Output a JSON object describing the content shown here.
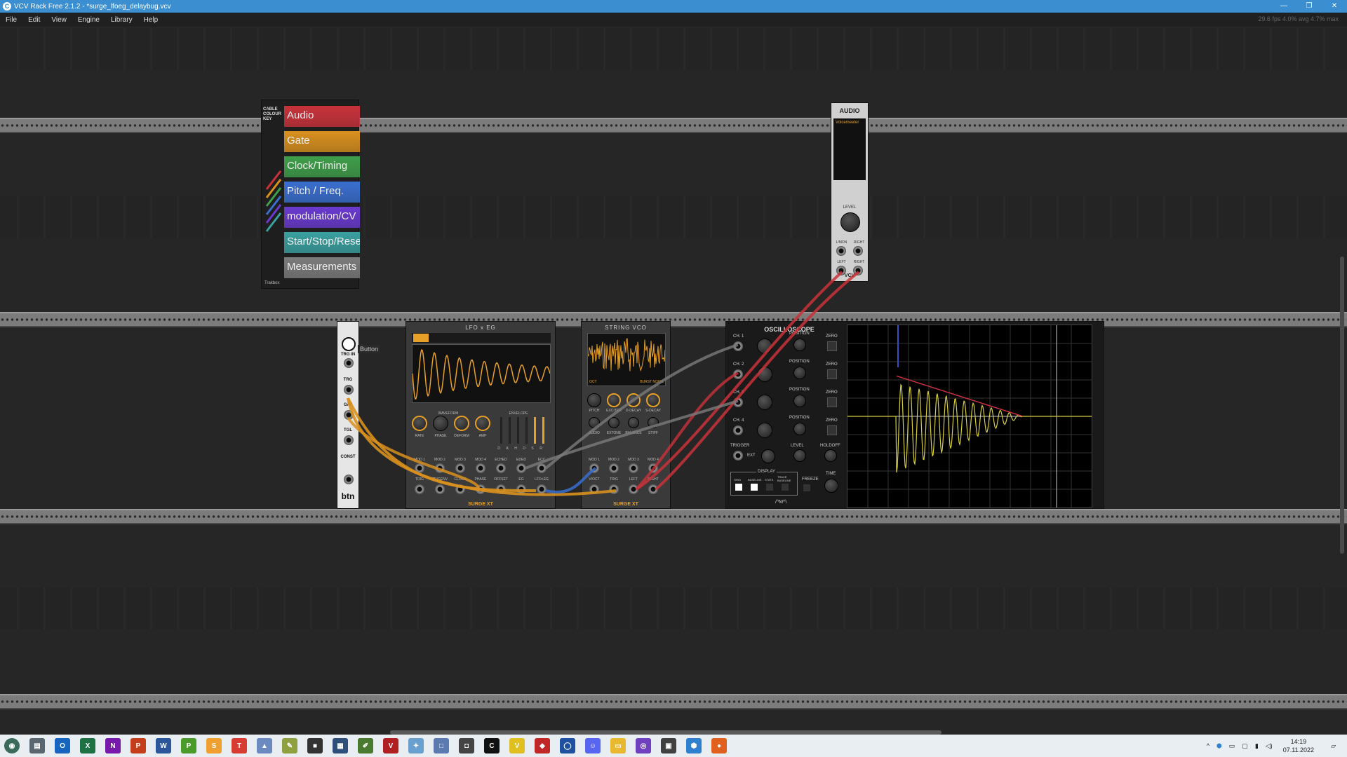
{
  "window": {
    "title": "VCV Rack Free 2.1.2 - *surge_lfoeg_delaybug.vcv",
    "minimize": "—",
    "restore": "❐",
    "close": "✕"
  },
  "menu": {
    "items": [
      "File",
      "Edit",
      "View",
      "Engine",
      "Library",
      "Help"
    ],
    "stats": "29.6 fps  4.0% avg  4.7% max"
  },
  "cable_key": {
    "title": "CABLE COLOUR KEY",
    "footer": "Trakbox",
    "bands": [
      {
        "label": "Audio",
        "color": "#c9323a"
      },
      {
        "label": "Gate",
        "color": "#d9901e"
      },
      {
        "label": "Clock/Timing",
        "color": "#3f9f4a"
      },
      {
        "label": "Pitch / Freq.",
        "color": "#3a6fd0"
      },
      {
        "label": "modulation/CV",
        "color": "#6a3ad0"
      },
      {
        "label": "Start/Stop/Reset",
        "color": "#3aa0a0"
      },
      {
        "label": "Measurements",
        "color": "#7c7c7c"
      }
    ]
  },
  "audio": {
    "title": "AUDIO",
    "device": "Voicemeeter",
    "level_label": "LEVEL",
    "brand": "VCV",
    "in_labels": [
      "L/MON",
      "RIGHT"
    ],
    "out_labels": [
      "LEFT",
      "RIGHT"
    ]
  },
  "button_module": {
    "labels": [
      "TRG IN",
      "TRG",
      "GAT",
      "TGL",
      "CONST"
    ],
    "name": "btn",
    "tooltip": "Button"
  },
  "lfo": {
    "title": "LFO x EG",
    "footer": "SURGE XT",
    "knob_labels": [
      "RATE",
      "PHASE",
      "DEFORM",
      "AMP"
    ],
    "section_labels": [
      "WAVEFORM",
      "ENVELOPE"
    ],
    "eg_labels": [
      "D",
      "A",
      "H",
      "D",
      "S",
      "R"
    ],
    "mod_labels": [
      "MOD 1",
      "MOD 2",
      "MOD 3",
      "MOD 4",
      "ECHED",
      "EDED",
      "ECC"
    ],
    "io_labels": [
      "TRIG",
      "TRIGENV",
      "CLOCK",
      "PHASE",
      "OFFSET",
      "EG",
      "LFO+EG"
    ]
  },
  "vco": {
    "title": "STRING VCO",
    "footer": "SURGE XT",
    "screen_labels": [
      "OCT",
      "BURST NOISE"
    ],
    "knob_labels": [
      "PITCH",
      "EXCITER",
      "D-DECAY",
      "S-DECAY"
    ],
    "knob_labels_2": [
      "AUDIO",
      "EXTONE",
      "BALANCE",
      "STIFF"
    ],
    "mod_labels": [
      "MOD 1",
      "MOD 2",
      "MOD 3",
      "MOD 4"
    ],
    "io_labels": [
      "V/OCT",
      "TRIG",
      "LEFT",
      "RIGHT"
    ]
  },
  "scope": {
    "title": "OSCILLOSCOPE",
    "channels": [
      "CH. 1",
      "CH. 2",
      "CH. 3",
      "CH. 4"
    ],
    "position_label": "POSITION",
    "zero_label": "ZERO",
    "trigger_label": "TRIGGER",
    "level_label": "LEVEL",
    "holdoff_label": "HOLDOFF",
    "time_label": "TIME",
    "display_label": "DISPLAY",
    "display_opts": [
      "GRID",
      "BASELINE",
      "STATS",
      "TRACE BASELINE"
    ],
    "freeze_label": "FREEZE",
    "ext_label": "EXT",
    "brand": "/^M^\\"
  },
  "taskbar": {
    "apps": [
      {
        "name": "app-generic",
        "color": "#5b6770",
        "glyph": "▤"
      },
      {
        "name": "app-outlook",
        "color": "#1666c0",
        "glyph": "O"
      },
      {
        "name": "app-excel",
        "color": "#1e7145",
        "glyph": "X"
      },
      {
        "name": "app-onenote",
        "color": "#7719aa",
        "glyph": "N"
      },
      {
        "name": "app-powerpoint",
        "color": "#c43e1c",
        "glyph": "P"
      },
      {
        "name": "app-word",
        "color": "#2b579a",
        "glyph": "W"
      },
      {
        "name": "app-publisher",
        "color": "#4b9b2a",
        "glyph": "P"
      },
      {
        "name": "app-sublime",
        "color": "#f0a030",
        "glyph": "S"
      },
      {
        "name": "app-t",
        "color": "#d83b32",
        "glyph": "T"
      },
      {
        "name": "app-chart",
        "color": "#6a8ac0",
        "glyph": "▲"
      },
      {
        "name": "app-paint",
        "color": "#8fa040",
        "glyph": "✎"
      },
      {
        "name": "app-dark",
        "color": "#333333",
        "glyph": "■"
      },
      {
        "name": "app-calc",
        "color": "#2e4f7a",
        "glyph": "▦"
      },
      {
        "name": "app-edit",
        "color": "#4a7a30",
        "glyph": "✐"
      },
      {
        "name": "app-voicemeeter",
        "color": "#b02020",
        "glyph": "V"
      },
      {
        "name": "app-star",
        "color": "#6aa0d0",
        "glyph": "✦"
      },
      {
        "name": "app-window",
        "color": "#5a7ab0",
        "glyph": "□"
      },
      {
        "name": "app-device",
        "color": "#444444",
        "glyph": "◘"
      },
      {
        "name": "app-vcvrack",
        "color": "#111111",
        "glyph": "C"
      },
      {
        "name": "app-v",
        "color": "#e0c020",
        "glyph": "V"
      },
      {
        "name": "app-red",
        "color": "#c02828",
        "glyph": "◆"
      },
      {
        "name": "app-blue-ring",
        "color": "#2050a0",
        "glyph": "◯"
      },
      {
        "name": "app-discord",
        "color": "#5865f2",
        "glyph": "☺"
      },
      {
        "name": "app-folder",
        "color": "#e8b830",
        "glyph": "▭"
      },
      {
        "name": "app-purple",
        "color": "#7040c0",
        "glyph": "◎"
      },
      {
        "name": "app-terminal",
        "color": "#404040",
        "glyph": "▣"
      },
      {
        "name": "app-cube",
        "color": "#3080d0",
        "glyph": "⬢"
      },
      {
        "name": "app-firefox",
        "color": "#e06020",
        "glyph": "●"
      }
    ],
    "time": "14:19",
    "date": "07.11.2022"
  }
}
